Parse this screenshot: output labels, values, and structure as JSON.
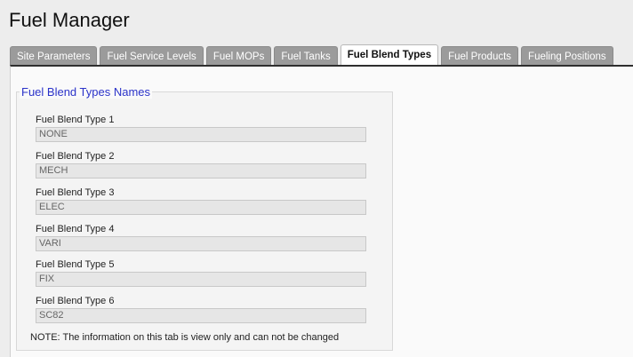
{
  "app": {
    "title": "Fuel Manager"
  },
  "tabs": [
    {
      "label": "Site Parameters"
    },
    {
      "label": "Fuel Service Levels"
    },
    {
      "label": "Fuel MOPs"
    },
    {
      "label": "Fuel Tanks"
    },
    {
      "label": "Fuel Blend Types"
    },
    {
      "label": "Fuel Products"
    },
    {
      "label": "Fueling Positions"
    }
  ],
  "active_tab": "Fuel Blend Types",
  "section": {
    "legend": "Fuel Blend Types Names"
  },
  "fields": [
    {
      "label": "Fuel Blend Type 1",
      "value": "NONE"
    },
    {
      "label": "Fuel Blend Type 2",
      "value": "MECH"
    },
    {
      "label": "Fuel Blend Type 3",
      "value": "ELEC"
    },
    {
      "label": "Fuel Blend Type 4",
      "value": "VARI"
    },
    {
      "label": "Fuel Blend Type 5",
      "value": "FIX"
    },
    {
      "label": "Fuel Blend Type 6",
      "value": "SC82"
    }
  ],
  "note": "NOTE: The information on this tab is view only and can not be changed",
  "colors": {
    "accent": "#2b33c9",
    "tab_inactive": "#9b9b9b",
    "tab_active": "#ffffff"
  }
}
